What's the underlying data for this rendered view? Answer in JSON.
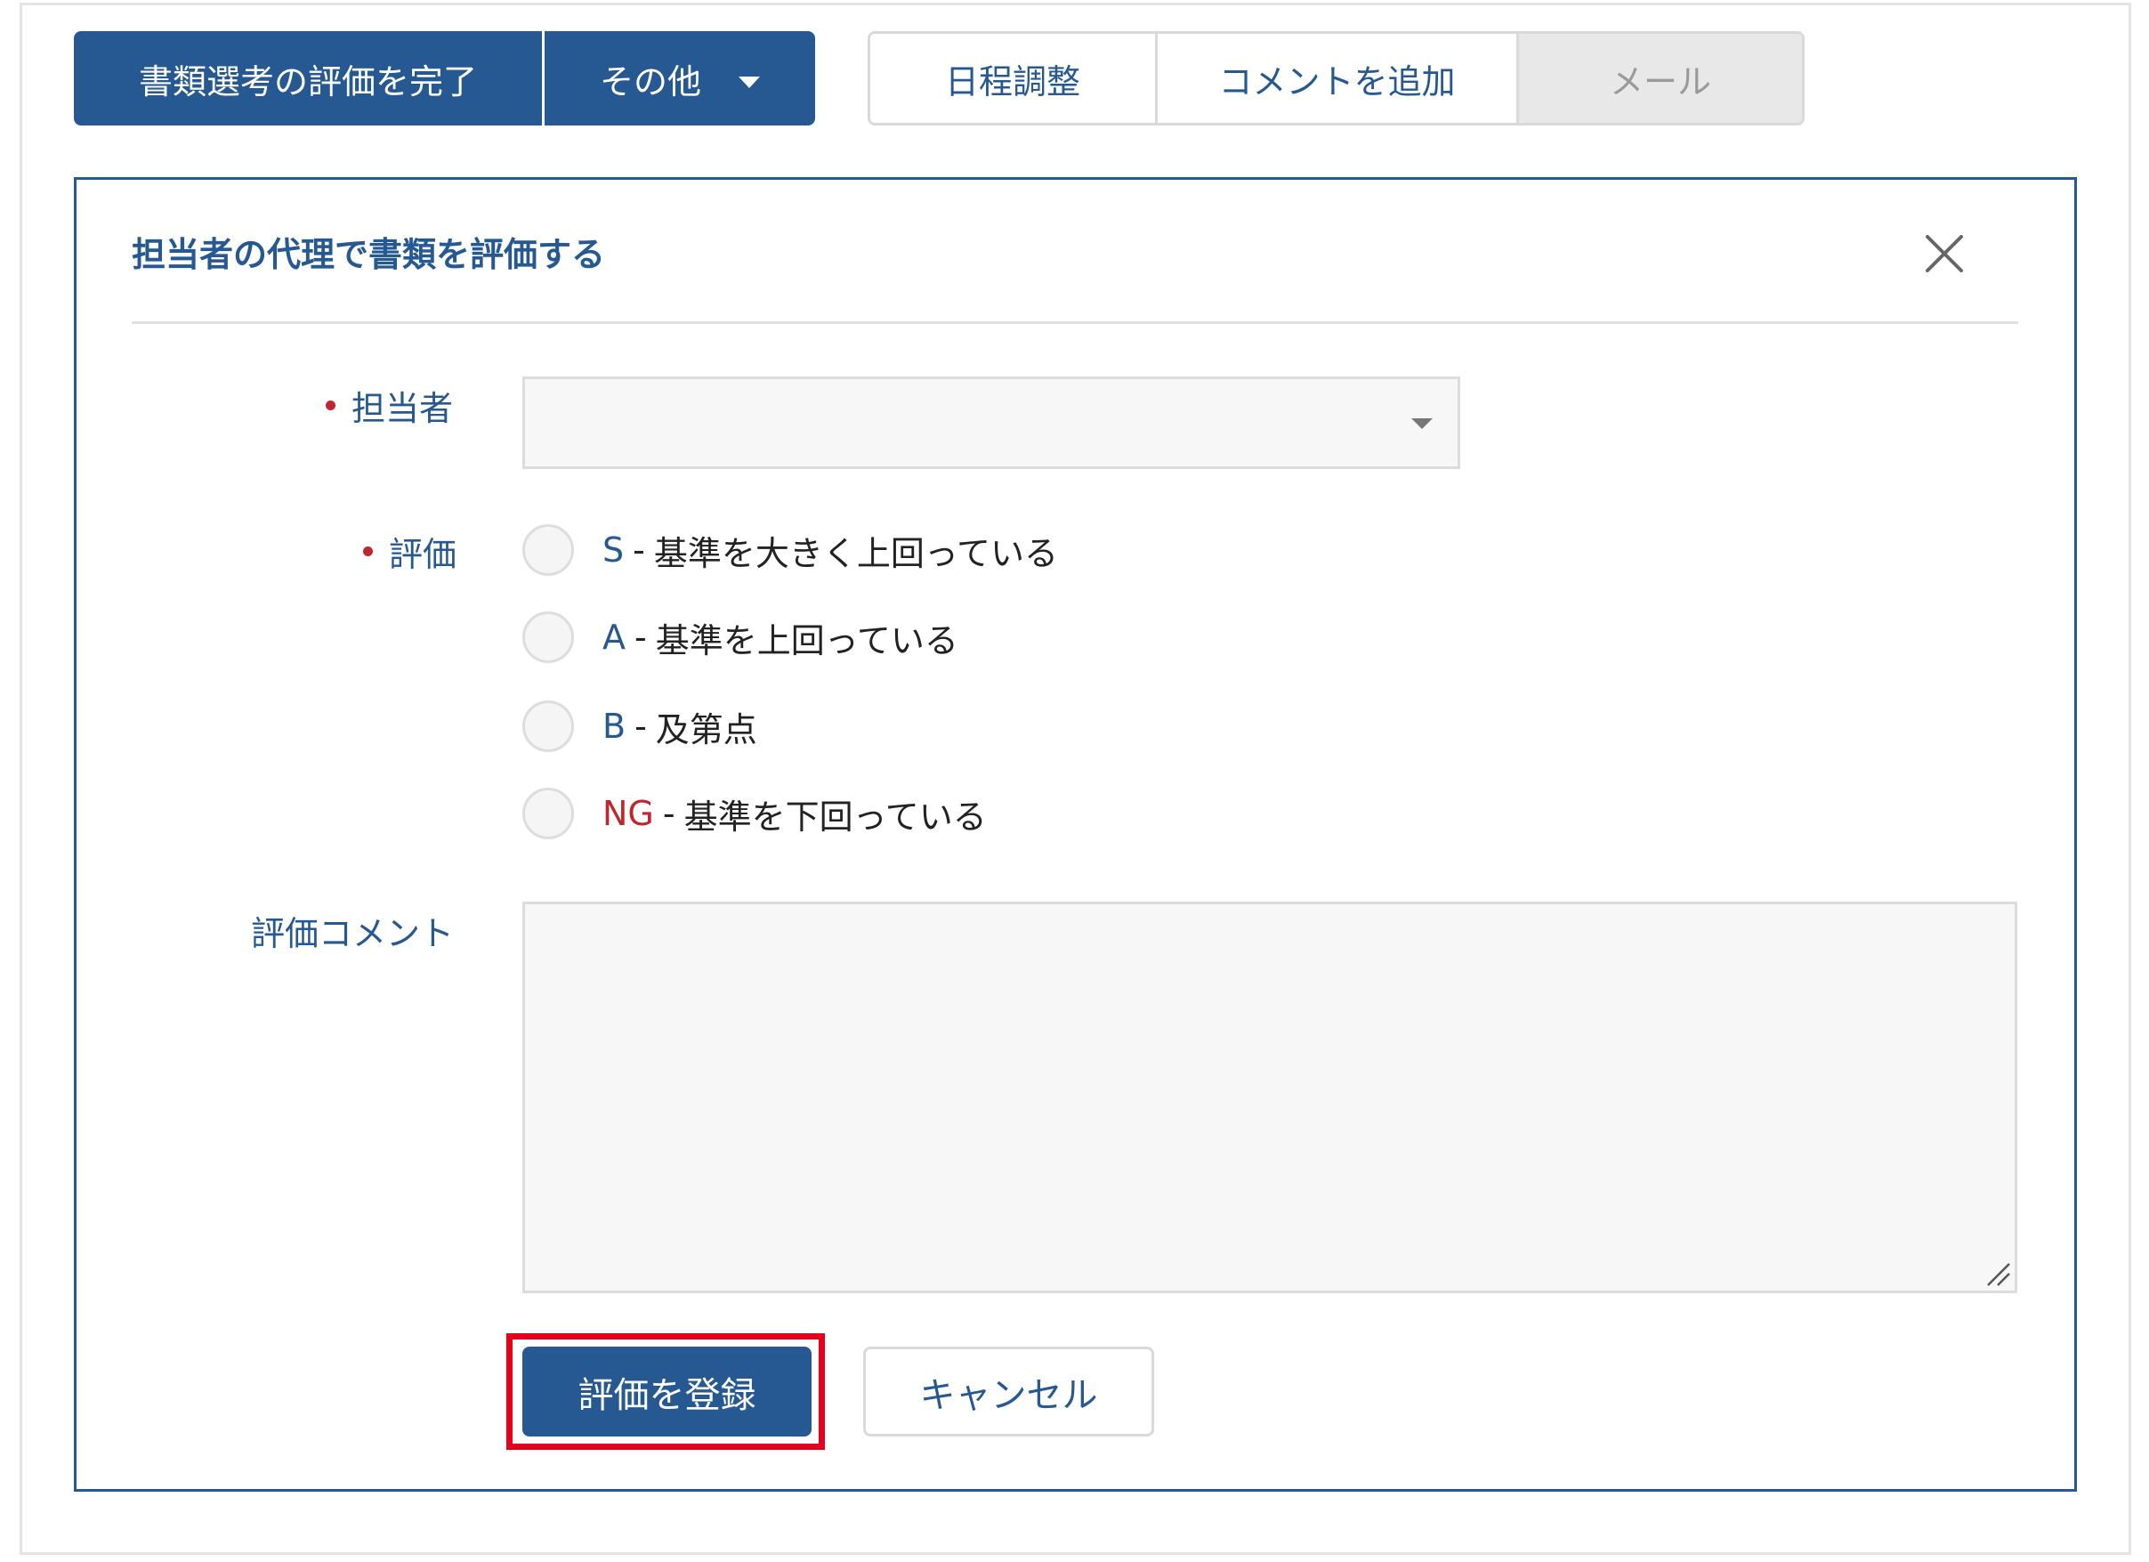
{
  "toolbar": {
    "complete_label": "書類選考の評価を完了",
    "other_label": "その他",
    "schedule_label": "日程調整",
    "add_comment_label": "コメントを追加",
    "mail_label": "メール"
  },
  "modal": {
    "title": "担当者の代理で書類を評価する",
    "assignee_label": "担当者",
    "assignee_value": "",
    "rating_label": "評価",
    "rating_options": [
      {
        "grade": "S",
        "separator": "-",
        "description": "基準を大きく上回っている",
        "color": "#265891"
      },
      {
        "grade": "A",
        "separator": "-",
        "description": "基準を上回っている",
        "color": "#265891"
      },
      {
        "grade": "B",
        "separator": "-",
        "description": "及第点",
        "color": "#265891"
      },
      {
        "grade": "NG",
        "separator": "-",
        "description": "基準を下回っている",
        "color": "#c0262d"
      }
    ],
    "comment_label": "評価コメント",
    "comment_value": "",
    "register_label": "評価を登録",
    "cancel_label": "キャンセル"
  },
  "colors": {
    "primary": "#265891",
    "required": "#c0262d",
    "highlight": "#e5001c"
  },
  "icons": {
    "close": "close-icon",
    "dropdown": "chevron-down-icon",
    "resize": "resize-handle-icon"
  }
}
